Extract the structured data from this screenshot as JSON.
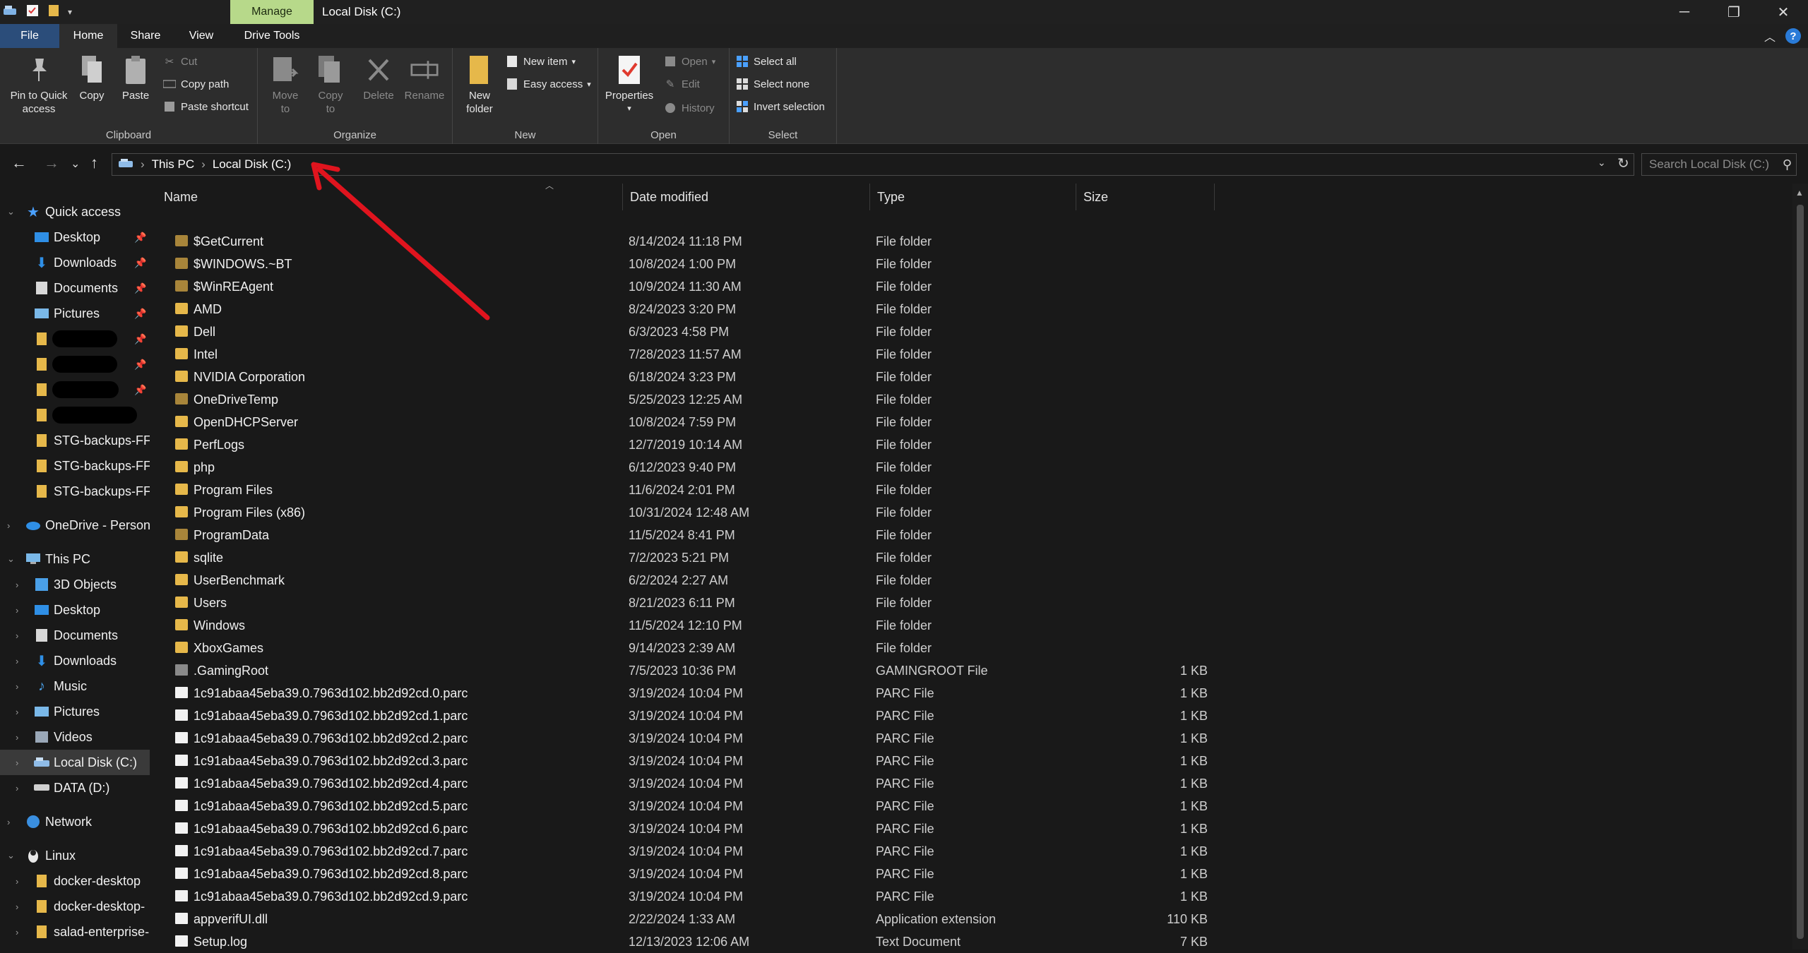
{
  "window": {
    "title": "Local Disk (C:)",
    "context_tab": "Manage",
    "min_glyph": "─",
    "restore_glyph": "❐",
    "close_glyph": "✕"
  },
  "ribbon_tabs": [
    "File",
    "Home",
    "Share",
    "View",
    "Drive Tools"
  ],
  "ribbon": {
    "clipboard": {
      "label": "Clipboard",
      "pin_l1": "Pin to Quick",
      "pin_l2": "access",
      "copy": "Copy",
      "paste": "Paste",
      "cut": "Cut",
      "copy_path": "Copy path",
      "paste_shortcut": "Paste shortcut"
    },
    "organize": {
      "label": "Organize",
      "move_l1": "Move",
      "move_l2": "to",
      "copy_l1": "Copy",
      "copy_l2": "to",
      "delete": "Delete",
      "rename": "Rename"
    },
    "new": {
      "label": "New",
      "folder_l1": "New",
      "folder_l2": "folder",
      "new_item": "New item",
      "easy_access": "Easy access"
    },
    "open": {
      "label": "Open",
      "properties": "Properties",
      "open": "Open",
      "edit": "Edit",
      "history": "History"
    },
    "select": {
      "label": "Select",
      "select_all": "Select all",
      "select_none": "Select none",
      "invert": "Invert selection"
    }
  },
  "address": {
    "crumbs": [
      "This PC",
      "Local Disk (C:)"
    ],
    "separator": "›",
    "search_placeholder": "Search Local Disk (C:)"
  },
  "nav": {
    "quick_access": "Quick access",
    "qa_items": [
      "Desktop",
      "Downloads",
      "Documents",
      "Pictures"
    ],
    "stg_items": [
      "STG-backups-FF-",
      "STG-backups-FF-",
      "STG-backups-FF-"
    ],
    "onedrive": "OneDrive - Persona",
    "this_pc": "This PC",
    "pc_items": [
      "3D Objects",
      "Desktop",
      "Documents",
      "Downloads",
      "Music",
      "Pictures",
      "Videos",
      "Local Disk (C:)",
      "DATA (D:)"
    ],
    "network": "Network",
    "linux": "Linux",
    "linux_items": [
      "docker-desktop",
      "docker-desktop-",
      "salad-enterprise-l"
    ]
  },
  "columns": {
    "name": "Name",
    "date": "Date modified",
    "type": "Type",
    "size": "Size"
  },
  "files": [
    {
      "name": "$GetCurrent",
      "date": "8/14/2024 11:18 PM",
      "type": "File folder",
      "size": "",
      "kind": "folder-dim"
    },
    {
      "name": "$WINDOWS.~BT",
      "date": "10/8/2024 1:00 PM",
      "type": "File folder",
      "size": "",
      "kind": "folder-dim"
    },
    {
      "name": "$WinREAgent",
      "date": "10/9/2024 11:30 AM",
      "type": "File folder",
      "size": "",
      "kind": "folder-dim"
    },
    {
      "name": "AMD",
      "date": "8/24/2023 3:20 PM",
      "type": "File folder",
      "size": "",
      "kind": "folder"
    },
    {
      "name": "Dell",
      "date": "6/3/2023 4:58 PM",
      "type": "File folder",
      "size": "",
      "kind": "folder"
    },
    {
      "name": "Intel",
      "date": "7/28/2023 11:57 AM",
      "type": "File folder",
      "size": "",
      "kind": "folder"
    },
    {
      "name": "NVIDIA Corporation",
      "date": "6/18/2024 3:23 PM",
      "type": "File folder",
      "size": "",
      "kind": "folder"
    },
    {
      "name": "OneDriveTemp",
      "date": "5/25/2023 12:25 AM",
      "type": "File folder",
      "size": "",
      "kind": "folder-dim"
    },
    {
      "name": "OpenDHCPServer",
      "date": "10/8/2024 7:59 PM",
      "type": "File folder",
      "size": "",
      "kind": "folder"
    },
    {
      "name": "PerfLogs",
      "date": "12/7/2019 10:14 AM",
      "type": "File folder",
      "size": "",
      "kind": "folder"
    },
    {
      "name": "php",
      "date": "6/12/2023 9:40 PM",
      "type": "File folder",
      "size": "",
      "kind": "folder"
    },
    {
      "name": "Program Files",
      "date": "11/6/2024 2:01 PM",
      "type": "File folder",
      "size": "",
      "kind": "folder"
    },
    {
      "name": "Program Files (x86)",
      "date": "10/31/2024 12:48 AM",
      "type": "File folder",
      "size": "",
      "kind": "folder"
    },
    {
      "name": "ProgramData",
      "date": "11/5/2024 8:41 PM",
      "type": "File folder",
      "size": "",
      "kind": "folder-dim"
    },
    {
      "name": "sqlite",
      "date": "7/2/2023 5:21 PM",
      "type": "File folder",
      "size": "",
      "kind": "folder"
    },
    {
      "name": "UserBenchmark",
      "date": "6/2/2024 2:27 AM",
      "type": "File folder",
      "size": "",
      "kind": "folder"
    },
    {
      "name": "Users",
      "date": "8/21/2023 6:11 PM",
      "type": "File folder",
      "size": "",
      "kind": "folder"
    },
    {
      "name": "Windows",
      "date": "11/5/2024 12:10 PM",
      "type": "File folder",
      "size": "",
      "kind": "folder"
    },
    {
      "name": "XboxGames",
      "date": "9/14/2023 2:39 AM",
      "type": "File folder",
      "size": "",
      "kind": "folder"
    },
    {
      "name": ".GamingRoot",
      "date": "7/5/2023 10:36 PM",
      "type": "GAMINGROOT File",
      "size": "1 KB",
      "kind": "file-grey"
    },
    {
      "name": "1c91abaa45eba39.0.7963d102.bb2d92cd.0.parc",
      "date": "3/19/2024 10:04 PM",
      "type": "PARC File",
      "size": "1 KB",
      "kind": "file"
    },
    {
      "name": "1c91abaa45eba39.0.7963d102.bb2d92cd.1.parc",
      "date": "3/19/2024 10:04 PM",
      "type": "PARC File",
      "size": "1 KB",
      "kind": "file"
    },
    {
      "name": "1c91abaa45eba39.0.7963d102.bb2d92cd.2.parc",
      "date": "3/19/2024 10:04 PM",
      "type": "PARC File",
      "size": "1 KB",
      "kind": "file"
    },
    {
      "name": "1c91abaa45eba39.0.7963d102.bb2d92cd.3.parc",
      "date": "3/19/2024 10:04 PM",
      "type": "PARC File",
      "size": "1 KB",
      "kind": "file"
    },
    {
      "name": "1c91abaa45eba39.0.7963d102.bb2d92cd.4.parc",
      "date": "3/19/2024 10:04 PM",
      "type": "PARC File",
      "size": "1 KB",
      "kind": "file"
    },
    {
      "name": "1c91abaa45eba39.0.7963d102.bb2d92cd.5.parc",
      "date": "3/19/2024 10:04 PM",
      "type": "PARC File",
      "size": "1 KB",
      "kind": "file"
    },
    {
      "name": "1c91abaa45eba39.0.7963d102.bb2d92cd.6.parc",
      "date": "3/19/2024 10:04 PM",
      "type": "PARC File",
      "size": "1 KB",
      "kind": "file"
    },
    {
      "name": "1c91abaa45eba39.0.7963d102.bb2d92cd.7.parc",
      "date": "3/19/2024 10:04 PM",
      "type": "PARC File",
      "size": "1 KB",
      "kind": "file"
    },
    {
      "name": "1c91abaa45eba39.0.7963d102.bb2d92cd.8.parc",
      "date": "3/19/2024 10:04 PM",
      "type": "PARC File",
      "size": "1 KB",
      "kind": "file"
    },
    {
      "name": "1c91abaa45eba39.0.7963d102.bb2d92cd.9.parc",
      "date": "3/19/2024 10:04 PM",
      "type": "PARC File",
      "size": "1 KB",
      "kind": "file"
    },
    {
      "name": "appverifUI.dll",
      "date": "2/22/2024 1:33 AM",
      "type": "Application extension",
      "size": "110 KB",
      "kind": "file"
    },
    {
      "name": "Setup.log",
      "date": "12/13/2023 12:06 AM",
      "type": "Text Document",
      "size": "7 KB",
      "kind": "file"
    }
  ],
  "colors": {
    "folder": "#e6b84a",
    "accent": "#2b4d7a",
    "annotation_arrow": "#e0141e"
  }
}
